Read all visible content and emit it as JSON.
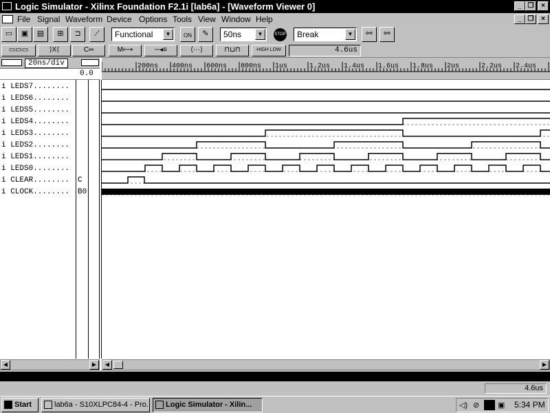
{
  "window": {
    "title": "Logic Simulator - Xilinx Foundation F2.1i [lab6a] - [Waveform Viewer 0]"
  },
  "menu": [
    "File",
    "Signal",
    "Waveform",
    "Device",
    "Options",
    "Tools",
    "View",
    "Window",
    "Help"
  ],
  "toolbar": {
    "sim_mode": "Functional",
    "step_size": "50ns",
    "break_mode": "Break",
    "on_label": "ON",
    "stop_label": "STOP"
  },
  "toolbar2": {
    "high_low_label": "HIGH LOW",
    "current_time": "4.6us"
  },
  "wave": {
    "scale": "20ns/div",
    "cursor_time": "0.0",
    "time_labels": [
      "200ns",
      "400ns",
      "600ns",
      "800ns",
      "1us",
      "1.2us",
      "1.4us",
      "1.6us",
      "1.8us",
      "2us",
      "2.2us",
      "2.4us"
    ],
    "signals": [
      {
        "prefix": "i",
        "name": "LEDS7",
        "value": ""
      },
      {
        "prefix": "i",
        "name": "LEDS6",
        "value": ""
      },
      {
        "prefix": "i",
        "name": "LEDS5",
        "value": ""
      },
      {
        "prefix": "i",
        "name": "LEDS4",
        "value": ""
      },
      {
        "prefix": "i",
        "name": "LEDS3",
        "value": ""
      },
      {
        "prefix": "i",
        "name": "LEDS2",
        "value": ""
      },
      {
        "prefix": "i",
        "name": "LEDS1",
        "value": ""
      },
      {
        "prefix": "i",
        "name": "LEDS0",
        "value": ""
      },
      {
        "prefix": "i",
        "name": "CLEAR",
        "value": "C"
      },
      {
        "prefix": "i",
        "name": "CLOCK",
        "value": "B0"
      }
    ]
  },
  "status": {
    "time": "4.6us"
  },
  "taskbar": {
    "start": "Start",
    "tasks": [
      "lab6a - S10XLPC84-4 - Pro...",
      "Logic Simulator - Xilin..."
    ],
    "clock": "5:34 PM"
  },
  "colors": {
    "title_bg": "#000000",
    "chrome": "#c0c0c0",
    "wave_bg": "#ffffff"
  }
}
